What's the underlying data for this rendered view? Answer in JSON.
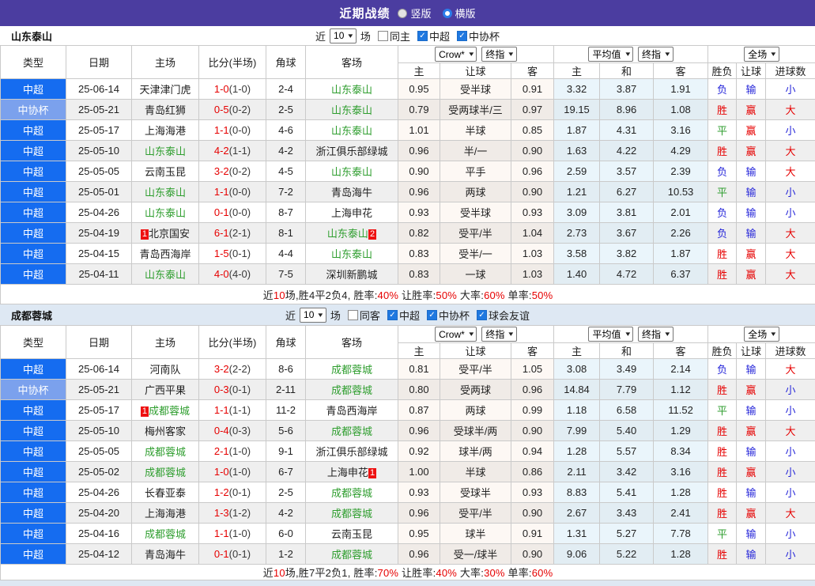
{
  "colors": {
    "topbar_bg": "#4b3da0",
    "league_csl_bg": "#156cf0",
    "league_cup_bg": "#7ba1ed",
    "focus_team_green": "#2f9e2f",
    "score_red": "#e60000",
    "win_red": "#e60000",
    "draw_green": "#2f9e2f",
    "lose_blue": "#2626d9",
    "row_alt_gray": "#efefef",
    "europe_col_tint": "#eaf5fb",
    "section2_bg": "#dee8f3"
  },
  "top_bar": {
    "title": "近期战绩",
    "radios": [
      {
        "label": "竖版",
        "selected": false
      },
      {
        "label": "横版",
        "selected": true
      }
    ]
  },
  "filter_labels": {
    "near": "近",
    "matches": "场"
  },
  "columns": {
    "type": "类型",
    "date": "日期",
    "home": "主场",
    "score": "比分(半场)",
    "corner": "角球",
    "away": "客场",
    "ah_home": "主",
    "ah_line": "让球",
    "ah_away": "客",
    "eu_home": "主",
    "eu_draw": "和",
    "eu_away": "客",
    "res_wdl": "胜负",
    "res_ah": "让球",
    "res_goals": "进球数"
  },
  "dropdowns": {
    "ah_source": "Crow*",
    "ah_time": "终指",
    "eu_source": "平均值",
    "eu_time": "终指",
    "res_scope": "全场"
  },
  "sections": [
    {
      "team": "山东泰山",
      "filter": {
        "count": "10",
        "checkboxes": [
          {
            "label": "同主",
            "checked": false
          },
          {
            "label": "中超",
            "checked": true
          },
          {
            "label": "中协杯",
            "checked": true
          }
        ]
      },
      "rows": [
        {
          "type": "中超",
          "kind": "csl",
          "date": "25-06-14",
          "home": {
            "name": "天津津门虎",
            "focus": false,
            "badge": ""
          },
          "score": "1-0",
          "half": "(1-0)",
          "corners": "2-4",
          "away": {
            "name": "山东泰山",
            "focus": true,
            "badge": ""
          },
          "handicap": [
            "0.95",
            "受半球",
            "0.91"
          ],
          "europe": [
            "3.32",
            "3.87",
            "1.91"
          ],
          "results": [
            [
              "负",
              "b"
            ],
            [
              "输",
              "b"
            ],
            [
              "小",
              "b"
            ]
          ]
        },
        {
          "type": "中协杯",
          "kind": "cup",
          "date": "25-05-21",
          "home": {
            "name": "青岛红狮",
            "focus": false,
            "badge": ""
          },
          "score": "0-5",
          "half": "(0-2)",
          "corners": "2-5",
          "away": {
            "name": "山东泰山",
            "focus": true,
            "badge": ""
          },
          "handicap": [
            "0.79",
            "受两球半/三",
            "0.97"
          ],
          "europe": [
            "19.15",
            "8.96",
            "1.08"
          ],
          "results": [
            [
              "胜",
              "r"
            ],
            [
              "赢",
              "r"
            ],
            [
              "大",
              "r"
            ]
          ]
        },
        {
          "type": "中超",
          "kind": "csl",
          "date": "25-05-17",
          "home": {
            "name": "上海海港",
            "focus": false,
            "badge": ""
          },
          "score": "1-1",
          "half": "(0-0)",
          "corners": "4-6",
          "away": {
            "name": "山东泰山",
            "focus": true,
            "badge": ""
          },
          "handicap": [
            "1.01",
            "半球",
            "0.85"
          ],
          "europe": [
            "1.87",
            "4.31",
            "3.16"
          ],
          "results": [
            [
              "平",
              "g"
            ],
            [
              "赢",
              "r"
            ],
            [
              "小",
              "b"
            ]
          ]
        },
        {
          "type": "中超",
          "kind": "csl",
          "date": "25-05-10",
          "home": {
            "name": "山东泰山",
            "focus": true,
            "badge": ""
          },
          "score": "4-2",
          "half": "(1-1)",
          "corners": "4-2",
          "away": {
            "name": "浙江俱乐部绿城",
            "focus": false,
            "badge": ""
          },
          "handicap": [
            "0.96",
            "半/一",
            "0.90"
          ],
          "europe": [
            "1.63",
            "4.22",
            "4.29"
          ],
          "results": [
            [
              "胜",
              "r"
            ],
            [
              "赢",
              "r"
            ],
            [
              "大",
              "r"
            ]
          ]
        },
        {
          "type": "中超",
          "kind": "csl",
          "date": "25-05-05",
          "home": {
            "name": "云南玉昆",
            "focus": false,
            "badge": ""
          },
          "score": "3-2",
          "half": "(0-2)",
          "corners": "4-5",
          "away": {
            "name": "山东泰山",
            "focus": true,
            "badge": ""
          },
          "handicap": [
            "0.90",
            "平手",
            "0.96"
          ],
          "europe": [
            "2.59",
            "3.57",
            "2.39"
          ],
          "results": [
            [
              "负",
              "b"
            ],
            [
              "输",
              "b"
            ],
            [
              "大",
              "r"
            ]
          ]
        },
        {
          "type": "中超",
          "kind": "csl",
          "date": "25-05-01",
          "home": {
            "name": "山东泰山",
            "focus": true,
            "badge": ""
          },
          "score": "1-1",
          "half": "(0-0)",
          "corners": "7-2",
          "away": {
            "name": "青岛海牛",
            "focus": false,
            "badge": ""
          },
          "handicap": [
            "0.96",
            "两球",
            "0.90"
          ],
          "europe": [
            "1.21",
            "6.27",
            "10.53"
          ],
          "results": [
            [
              "平",
              "g"
            ],
            [
              "输",
              "b"
            ],
            [
              "小",
              "b"
            ]
          ]
        },
        {
          "type": "中超",
          "kind": "csl",
          "date": "25-04-26",
          "home": {
            "name": "山东泰山",
            "focus": true,
            "badge": ""
          },
          "score": "0-1",
          "half": "(0-0)",
          "corners": "8-7",
          "away": {
            "name": "上海申花",
            "focus": false,
            "badge": ""
          },
          "handicap": [
            "0.93",
            "受半球",
            "0.93"
          ],
          "europe": [
            "3.09",
            "3.81",
            "2.01"
          ],
          "results": [
            [
              "负",
              "b"
            ],
            [
              "输",
              "b"
            ],
            [
              "小",
              "b"
            ]
          ]
        },
        {
          "type": "中超",
          "kind": "csl",
          "date": "25-04-19",
          "home": {
            "name": "北京国安",
            "focus": false,
            "badge": "1"
          },
          "score": "6-1",
          "half": "(2-1)",
          "corners": "8-1",
          "away": {
            "name": "山东泰山",
            "focus": true,
            "badge": "2"
          },
          "handicap": [
            "0.82",
            "受平/半",
            "1.04"
          ],
          "europe": [
            "2.73",
            "3.67",
            "2.26"
          ],
          "results": [
            [
              "负",
              "b"
            ],
            [
              "输",
              "b"
            ],
            [
              "大",
              "r"
            ]
          ]
        },
        {
          "type": "中超",
          "kind": "csl",
          "date": "25-04-15",
          "home": {
            "name": "青岛西海岸",
            "focus": false,
            "badge": ""
          },
          "score": "1-5",
          "half": "(0-1)",
          "corners": "4-4",
          "away": {
            "name": "山东泰山",
            "focus": true,
            "badge": ""
          },
          "handicap": [
            "0.83",
            "受半/一",
            "1.03"
          ],
          "europe": [
            "3.58",
            "3.82",
            "1.87"
          ],
          "results": [
            [
              "胜",
              "r"
            ],
            [
              "赢",
              "r"
            ],
            [
              "大",
              "r"
            ]
          ]
        },
        {
          "type": "中超",
          "kind": "csl",
          "date": "25-04-11",
          "home": {
            "name": "山东泰山",
            "focus": true,
            "badge": ""
          },
          "score": "4-0",
          "half": "(4-0)",
          "corners": "7-5",
          "away": {
            "name": "深圳新鹏城",
            "focus": false,
            "badge": ""
          },
          "handicap": [
            "0.83",
            "一球",
            "1.03"
          ],
          "europe": [
            "1.40",
            "4.72",
            "6.37"
          ],
          "results": [
            [
              "胜",
              "r"
            ],
            [
              "赢",
              "r"
            ],
            [
              "大",
              "r"
            ]
          ]
        }
      ],
      "summary": [
        {
          "t": "近",
          "c": "k"
        },
        {
          "t": "10",
          "c": "r"
        },
        {
          "t": "场,胜4平2负4, 胜率:",
          "c": "k"
        },
        {
          "t": "40%",
          "c": "r"
        },
        {
          "t": " 让胜率:",
          "c": "k"
        },
        {
          "t": "50%",
          "c": "r"
        },
        {
          "t": " 大率:",
          "c": "k"
        },
        {
          "t": "60%",
          "c": "r"
        },
        {
          "t": " 单率:",
          "c": "k"
        },
        {
          "t": "50%",
          "c": "r"
        }
      ]
    },
    {
      "team": "成都蓉城",
      "filter": {
        "count": "10",
        "checkboxes": [
          {
            "label": "同客",
            "checked": false
          },
          {
            "label": "中超",
            "checked": true
          },
          {
            "label": "中协杯",
            "checked": true
          },
          {
            "label": "球会友谊",
            "checked": true
          }
        ]
      },
      "rows": [
        {
          "type": "中超",
          "kind": "csl",
          "date": "25-06-14",
          "home": {
            "name": "河南队",
            "focus": false,
            "badge": ""
          },
          "score": "3-2",
          "half": "(2-2)",
          "corners": "8-6",
          "away": {
            "name": "成都蓉城",
            "focus": true,
            "badge": ""
          },
          "handicap": [
            "0.81",
            "受平/半",
            "1.05"
          ],
          "europe": [
            "3.08",
            "3.49",
            "2.14"
          ],
          "results": [
            [
              "负",
              "b"
            ],
            [
              "输",
              "b"
            ],
            [
              "大",
              "r"
            ]
          ]
        },
        {
          "type": "中协杯",
          "kind": "cup",
          "date": "25-05-21",
          "home": {
            "name": "广西平果",
            "focus": false,
            "badge": ""
          },
          "score": "0-3",
          "half": "(0-1)",
          "corners": "2-11",
          "away": {
            "name": "成都蓉城",
            "focus": true,
            "badge": ""
          },
          "handicap": [
            "0.80",
            "受两球",
            "0.96"
          ],
          "europe": [
            "14.84",
            "7.79",
            "1.12"
          ],
          "results": [
            [
              "胜",
              "r"
            ],
            [
              "赢",
              "r"
            ],
            [
              "小",
              "b"
            ]
          ]
        },
        {
          "type": "中超",
          "kind": "csl",
          "date": "25-05-17",
          "home": {
            "name": "成都蓉城",
            "focus": true,
            "badge": "1"
          },
          "score": "1-1",
          "half": "(1-1)",
          "corners": "11-2",
          "away": {
            "name": "青岛西海岸",
            "focus": false,
            "badge": ""
          },
          "handicap": [
            "0.87",
            "两球",
            "0.99"
          ],
          "europe": [
            "1.18",
            "6.58",
            "11.52"
          ],
          "results": [
            [
              "平",
              "g"
            ],
            [
              "输",
              "b"
            ],
            [
              "小",
              "b"
            ]
          ]
        },
        {
          "type": "中超",
          "kind": "csl",
          "date": "25-05-10",
          "home": {
            "name": "梅州客家",
            "focus": false,
            "badge": ""
          },
          "score": "0-4",
          "half": "(0-3)",
          "corners": "5-6",
          "away": {
            "name": "成都蓉城",
            "focus": true,
            "badge": ""
          },
          "handicap": [
            "0.96",
            "受球半/两",
            "0.90"
          ],
          "europe": [
            "7.99",
            "5.40",
            "1.29"
          ],
          "results": [
            [
              "胜",
              "r"
            ],
            [
              "赢",
              "r"
            ],
            [
              "大",
              "r"
            ]
          ]
        },
        {
          "type": "中超",
          "kind": "csl",
          "date": "25-05-05",
          "home": {
            "name": "成都蓉城",
            "focus": true,
            "badge": ""
          },
          "score": "2-1",
          "half": "(1-0)",
          "corners": "9-1",
          "away": {
            "name": "浙江俱乐部绿城",
            "focus": false,
            "badge": ""
          },
          "handicap": [
            "0.92",
            "球半/两",
            "0.94"
          ],
          "europe": [
            "1.28",
            "5.57",
            "8.34"
          ],
          "results": [
            [
              "胜",
              "r"
            ],
            [
              "输",
              "b"
            ],
            [
              "小",
              "b"
            ]
          ]
        },
        {
          "type": "中超",
          "kind": "csl",
          "date": "25-05-02",
          "home": {
            "name": "成都蓉城",
            "focus": true,
            "badge": ""
          },
          "score": "1-0",
          "half": "(1-0)",
          "corners": "6-7",
          "away": {
            "name": "上海申花",
            "focus": false,
            "badge": "1"
          },
          "handicap": [
            "1.00",
            "半球",
            "0.86"
          ],
          "europe": [
            "2.11",
            "3.42",
            "3.16"
          ],
          "results": [
            [
              "胜",
              "r"
            ],
            [
              "赢",
              "r"
            ],
            [
              "小",
              "b"
            ]
          ]
        },
        {
          "type": "中超",
          "kind": "csl",
          "date": "25-04-26",
          "home": {
            "name": "长春亚泰",
            "focus": false,
            "badge": ""
          },
          "score": "1-2",
          "half": "(0-1)",
          "corners": "2-5",
          "away": {
            "name": "成都蓉城",
            "focus": true,
            "badge": ""
          },
          "handicap": [
            "0.93",
            "受球半",
            "0.93"
          ],
          "europe": [
            "8.83",
            "5.41",
            "1.28"
          ],
          "results": [
            [
              "胜",
              "r"
            ],
            [
              "输",
              "b"
            ],
            [
              "小",
              "b"
            ]
          ]
        },
        {
          "type": "中超",
          "kind": "csl",
          "date": "25-04-20",
          "home": {
            "name": "上海海港",
            "focus": false,
            "badge": ""
          },
          "score": "1-3",
          "half": "(1-2)",
          "corners": "4-2",
          "away": {
            "name": "成都蓉城",
            "focus": true,
            "badge": ""
          },
          "handicap": [
            "0.96",
            "受平/半",
            "0.90"
          ],
          "europe": [
            "2.67",
            "3.43",
            "2.41"
          ],
          "results": [
            [
              "胜",
              "r"
            ],
            [
              "赢",
              "r"
            ],
            [
              "大",
              "r"
            ]
          ]
        },
        {
          "type": "中超",
          "kind": "csl",
          "date": "25-04-16",
          "home": {
            "name": "成都蓉城",
            "focus": true,
            "badge": ""
          },
          "score": "1-1",
          "half": "(1-0)",
          "corners": "6-0",
          "away": {
            "name": "云南玉昆",
            "focus": false,
            "badge": ""
          },
          "handicap": [
            "0.95",
            "球半",
            "0.91"
          ],
          "europe": [
            "1.31",
            "5.27",
            "7.78"
          ],
          "results": [
            [
              "平",
              "g"
            ],
            [
              "输",
              "b"
            ],
            [
              "小",
              "b"
            ]
          ]
        },
        {
          "type": "中超",
          "kind": "csl",
          "date": "25-04-12",
          "home": {
            "name": "青岛海牛",
            "focus": false,
            "badge": ""
          },
          "score": "0-1",
          "half": "(0-1)",
          "corners": "1-2",
          "away": {
            "name": "成都蓉城",
            "focus": true,
            "badge": ""
          },
          "handicap": [
            "0.96",
            "受一/球半",
            "0.90"
          ],
          "europe": [
            "9.06",
            "5.22",
            "1.28"
          ],
          "results": [
            [
              "胜",
              "r"
            ],
            [
              "输",
              "b"
            ],
            [
              "小",
              "b"
            ]
          ]
        }
      ],
      "summary": [
        {
          "t": "近",
          "c": "k"
        },
        {
          "t": "10",
          "c": "r"
        },
        {
          "t": "场,胜7平2负1, 胜率:",
          "c": "k"
        },
        {
          "t": "70%",
          "c": "r"
        },
        {
          "t": " 让胜率:",
          "c": "k"
        },
        {
          "t": "40%",
          "c": "r"
        },
        {
          "t": " 大率:",
          "c": "k"
        },
        {
          "t": "30%",
          "c": "r"
        },
        {
          "t": " 单率:",
          "c": "k"
        },
        {
          "t": "60%",
          "c": "r"
        }
      ]
    }
  ]
}
